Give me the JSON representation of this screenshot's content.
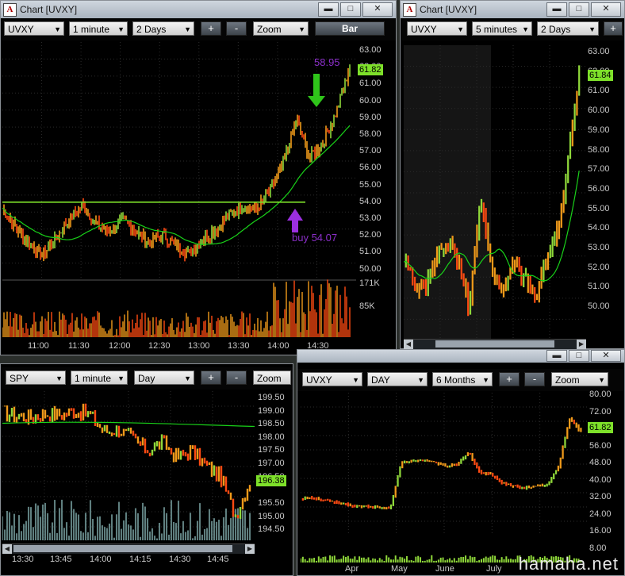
{
  "watermark": "hamaha.net",
  "windows": {
    "w1": {
      "title": "Chart [UVXY]",
      "toolbar": {
        "symbol": "UVXY",
        "interval": "1 minute",
        "range": "2 Days",
        "plus": "+",
        "minus": "-",
        "zoom": "Zoom",
        "bar": "Bar"
      },
      "price_labels": [
        "63.00",
        "62.00",
        "61.00",
        "60.00",
        "59.00",
        "58.00",
        "57.00",
        "56.00",
        "55.00",
        "54.00",
        "53.00",
        "52.00",
        "51.00",
        "50.00"
      ],
      "last_price": "61.82",
      "vol_labels": [
        "171K",
        "85K"
      ],
      "time_labels": [
        "11:00",
        "11:30",
        "12:00",
        "12:30",
        "13:00",
        "13:30",
        "14:00",
        "14:30"
      ],
      "annot_top": "58.95",
      "annot_buy": "buy 54.07"
    },
    "w2": {
      "title": "Chart [UVXY]",
      "toolbar": {
        "symbol": "UVXY",
        "interval": "5 minutes",
        "range": "2 Days",
        "plus": "+"
      },
      "price_labels": [
        "63.00",
        "62.00",
        "61.00",
        "60.00",
        "59.00",
        "58.00",
        "57.00",
        "56.00",
        "55.00",
        "54.00",
        "53.00",
        "52.00",
        "51.00",
        "50.00"
      ],
      "last_price": "61.84"
    },
    "w3": {
      "toolbar": {
        "symbol": "SPY",
        "interval": "1 minute",
        "range": "Day",
        "plus": "+",
        "minus": "-",
        "zoom": "Zoom"
      },
      "price_labels": [
        "199.50",
        "199.00",
        "198.50",
        "198.00",
        "197.50",
        "197.00",
        "196.50",
        "195.50",
        "195.00",
        "194.50"
      ],
      "last_price": "196.38",
      "time_labels": [
        "13:30",
        "13:45",
        "14:00",
        "14:15",
        "14:30",
        "14:45"
      ]
    },
    "w4": {
      "toolbar": {
        "symbol": "UVXY",
        "interval": "DAY",
        "range": "6 Months",
        "plus": "+",
        "minus": "-",
        "zoom": "Zoom"
      },
      "price_labels": [
        "80.00",
        "72.00",
        "64.00",
        "56.00",
        "48.00",
        "40.00",
        "32.00",
        "24.00",
        "16.00",
        "8.00"
      ],
      "last_price": "61.82",
      "time_labels": [
        "Apr",
        "May",
        "June",
        "July"
      ]
    }
  },
  "colors": {
    "up": "#8fd83a",
    "down": "#ff4a12",
    "mid": "#f09a1a",
    "ma": "#19d219",
    "resistance": "#7ee02a",
    "annot": "#8b2fc9",
    "vol": "#5f7f7f"
  }
}
